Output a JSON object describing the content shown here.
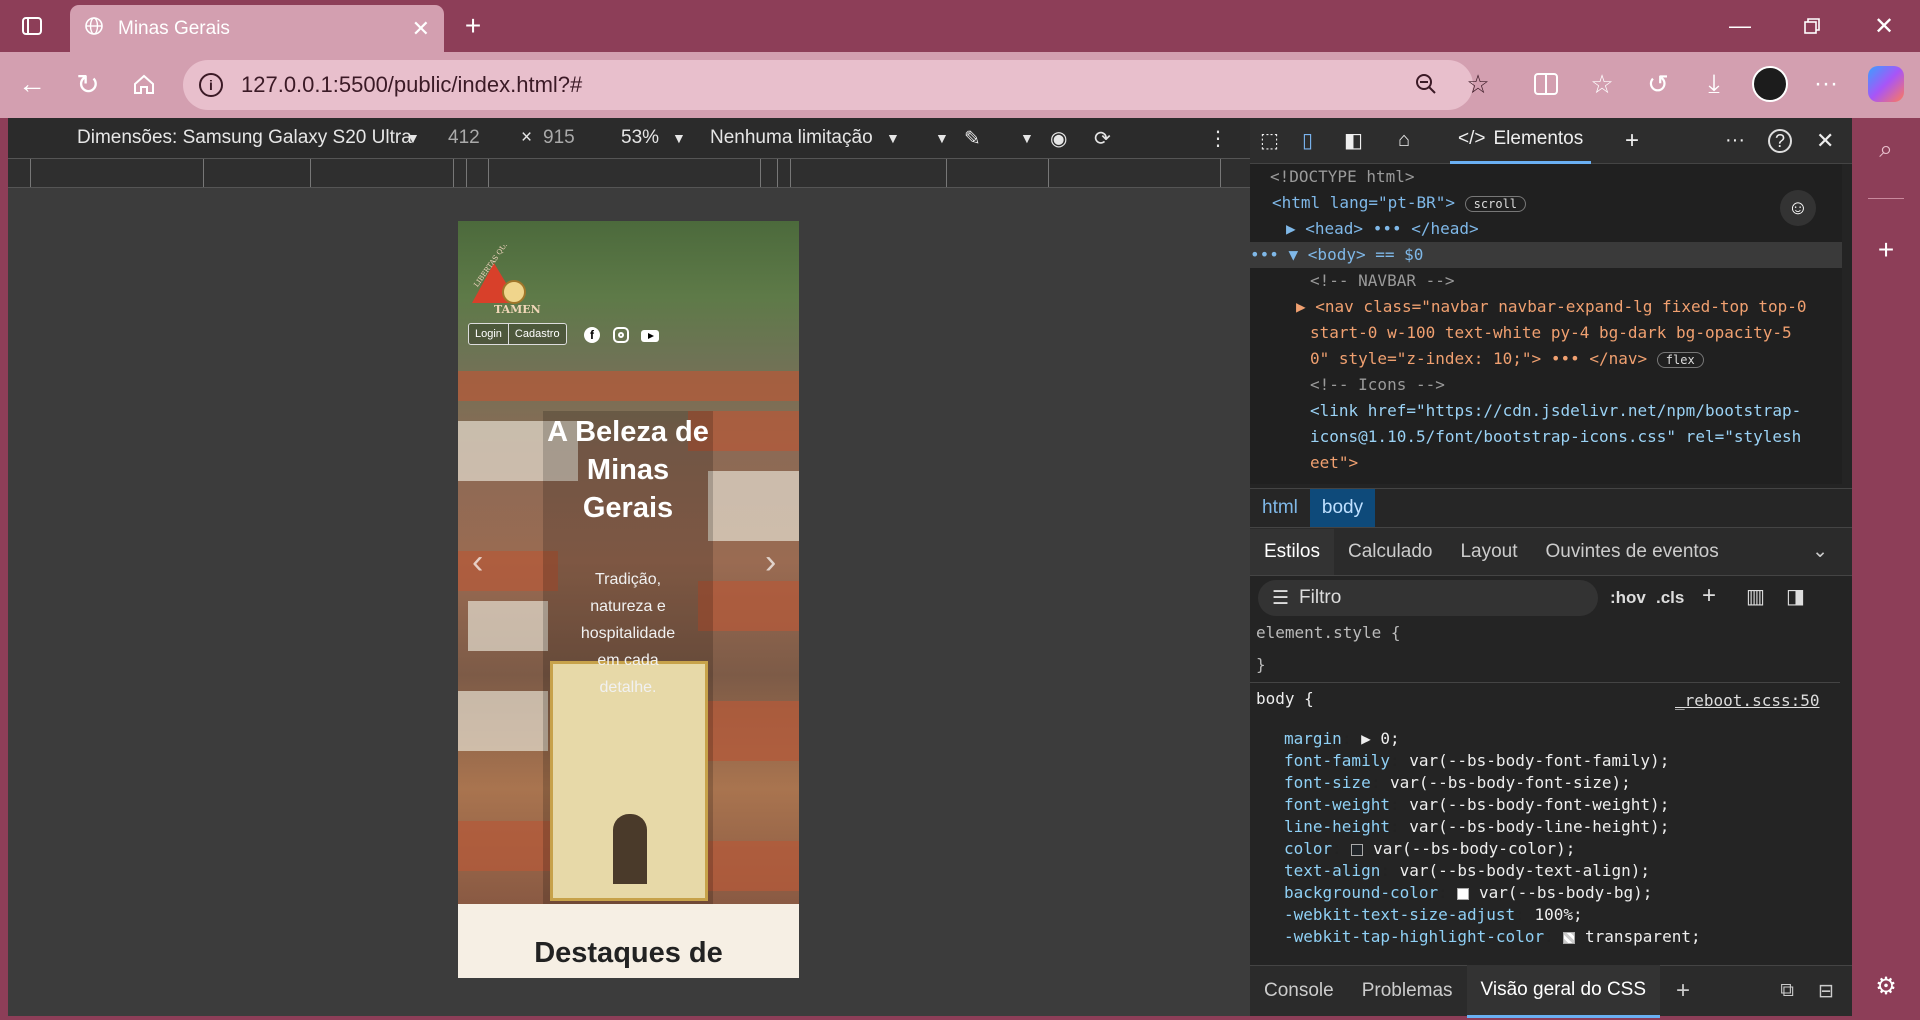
{
  "browser": {
    "tab_title": "Minas Gerais",
    "url": "127.0.0.1:5500/public/index.html?#"
  },
  "device_toolbar": {
    "dimensions_label": "Dimensões: Samsung Galaxy S20 Ultra",
    "width": "412",
    "times": "×",
    "height": "915",
    "zoom": "53%",
    "throttling": "Nenhuma limitação"
  },
  "site": {
    "logo_top": "LIBERTAS QUAE SERA",
    "logo_bottom": "TAMEN",
    "login_label": "Login",
    "signup_label": "Cadastro",
    "hero_title": "A Beleza de Minas Gerais",
    "hero_subtitle": "Tradição, natureza e hospitalidade em cada detalhe.",
    "prev_label": "‹",
    "next_label": "›",
    "section_title": "Destaques de"
  },
  "devtools": {
    "tab_elements": "Elementos",
    "dom_lines": [
      {
        "t": "<!DOCTYPE html>"
      },
      {
        "t": "<html lang=\"pt-BR\">",
        "badge": "scroll"
      },
      {
        "t": "▶ <head> ••• </head>"
      },
      {
        "t": "••• ▼ <body> == $0"
      },
      {
        "t": "<!-- NAVBAR -->"
      },
      {
        "t": "▶ <nav class=\"navbar navbar-expand-lg fixed-top top-0"
      },
      {
        "t": "start-0 w-100 text-white py-4 bg-dark bg-opacity-5"
      },
      {
        "t": "0\" style=\"z-index: 10;\"> ••• </nav>",
        "badge": "flex"
      },
      {
        "t": "<!-- Icons -->"
      },
      {
        "t": "<link href=\"https://cdn.jsdelivr.net/npm/bootstrap-"
      },
      {
        "t": "icons@1.10.5/font/bootstrap-icons.css\" rel=\"stylesh"
      },
      {
        "t": "eet\">"
      }
    ],
    "breadcrumbs": [
      "html",
      "body"
    ],
    "style_tabs": [
      "Estilos",
      "Calculado",
      "Layout",
      "Ouvintes de eventos"
    ],
    "filter_placeholder": "Filtro",
    "hov": ":hov",
    "cls": ".cls",
    "element_style": "element.style {",
    "close_brace": "}",
    "body_selector": "body {",
    "source_link": "_reboot.scss:50",
    "css_props": [
      {
        "p": "margin",
        "v": "▶ 0;"
      },
      {
        "p": "font-family",
        "v": "var(--bs-body-font-family);"
      },
      {
        "p": "font-size",
        "v": "var(--bs-body-font-size);"
      },
      {
        "p": "font-weight",
        "v": "var(--bs-body-font-weight);"
      },
      {
        "p": "line-height",
        "v": "var(--bs-body-line-height);"
      },
      {
        "p": "color",
        "v": "var(--bs-body-color);"
      },
      {
        "p": "text-align",
        "v": "var(--bs-body-text-align);"
      },
      {
        "p": "background-color",
        "v": "var(--bs-body-bg);"
      },
      {
        "p": "-webkit-text-size-adjust",
        "v": "100%;"
      },
      {
        "p": "-webkit-tap-highlight-color",
        "v": "transparent;"
      }
    ],
    "drawer_tabs": [
      "Console",
      "Problemas",
      "Visão geral do CSS"
    ]
  }
}
